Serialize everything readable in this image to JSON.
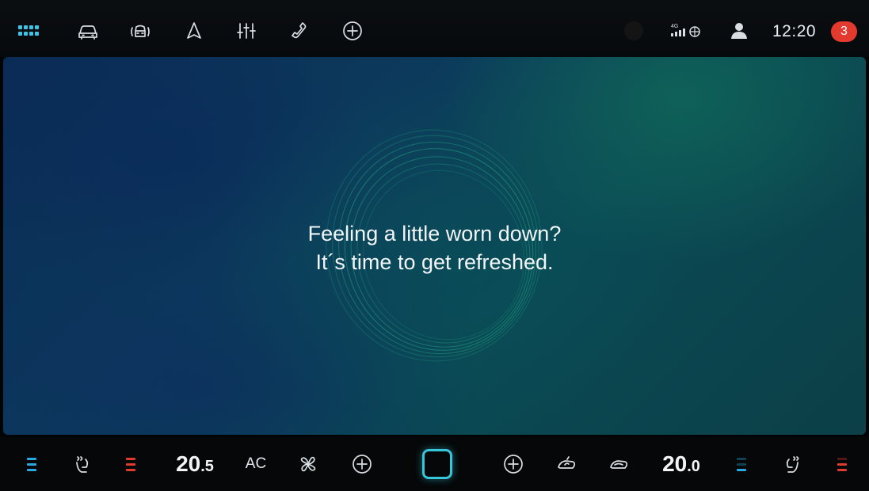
{
  "status_bar": {
    "icons": [
      "apps-grid-icon",
      "car-icon",
      "car-assist-icon",
      "navigation-icon",
      "equalizer-icon",
      "phone-icon",
      "add-icon",
      "signal-4g-icon",
      "profile-icon"
    ],
    "network_label": "4G",
    "time": "12:20",
    "notification_count": "3"
  },
  "main": {
    "headline_line1": "Feeling a little worn down?",
    "headline_line2": "It´s time to get refreshed."
  },
  "climate_bar": {
    "left_temp_int": "20",
    "left_temp_dec": ".5",
    "ac_label": "AC",
    "right_temp_int": "20",
    "right_temp_dec": ".0",
    "icons": [
      "left-seat-ventilation-icon",
      "left-seat-heating-icon",
      "fan-icon",
      "add-icon",
      "home-button",
      "air-recirculation-icon",
      "air-circulation-icon",
      "right-seat-icon",
      "right-seat-heating-icon"
    ]
  },
  "colors": {
    "accent": "#36c5d9",
    "heating": "#e23a2e",
    "cooling": "#2aa9e0",
    "notification": "#e23a2e"
  }
}
